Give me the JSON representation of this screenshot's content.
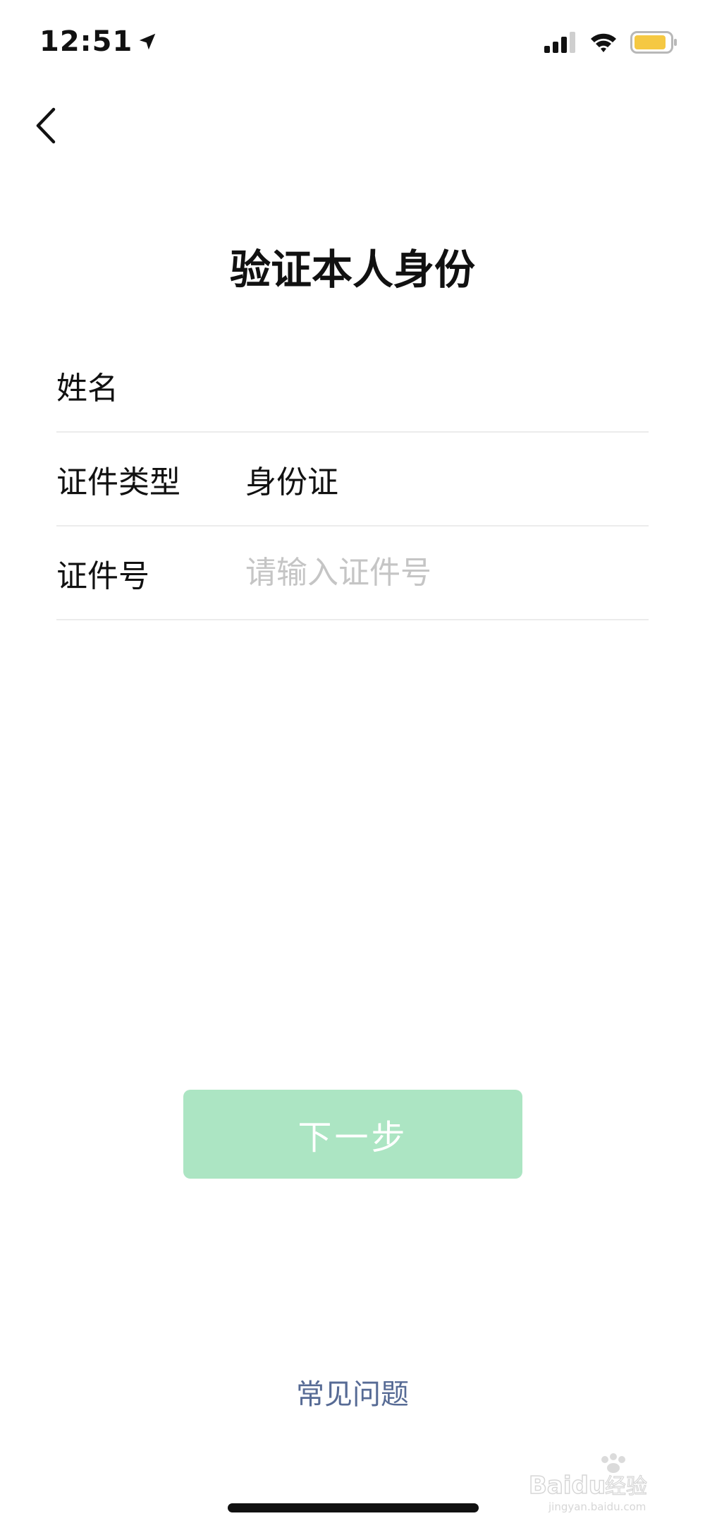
{
  "status_bar": {
    "time": "12:51",
    "icons": [
      "location-arrow-icon",
      "signal-icon",
      "wifi-icon",
      "battery-icon"
    ],
    "battery_color": "#f5c842"
  },
  "nav": {
    "back_icon": "chevron-left-icon"
  },
  "title": "验证本人身份",
  "form": {
    "name_label": "姓名",
    "name_value": "",
    "id_type_label": "证件类型",
    "id_type_value": "身份证",
    "id_number_label": "证件号",
    "id_number_placeholder": "请输入证件号",
    "id_number_value": ""
  },
  "next_button": {
    "label": "下一步",
    "color": "#ace5c3",
    "disabled": true
  },
  "faq": {
    "label": "常见问题",
    "color": "#576b95"
  },
  "watermark": {
    "text": "Baidu经验",
    "subtext": "jingyan.baidu.com"
  }
}
